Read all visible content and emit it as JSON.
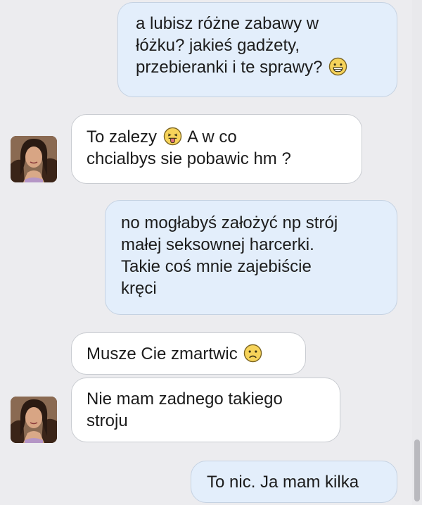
{
  "messages": [
    {
      "sender": "me",
      "lines": [
        "a lubisz różne zabawy w",
        "łóżku? jakieś gadżety,",
        "przebieranki i te sprawy?"
      ],
      "emoji": "grinning-emoji"
    },
    {
      "sender": "them",
      "line1_pre": "To zalezy",
      "line1_emoji": "tongue-out-emoji",
      "line1_post": "A w co",
      "line2": "chcialbys sie pobawic hm ?"
    },
    {
      "sender": "me",
      "lines": [
        "no mogłabyś założyć np strój",
        "małej seksownej harcerki.",
        "Takie coś mnie zajebiście",
        "kręci"
      ]
    },
    {
      "sender": "them",
      "text": "Musze Cie zmartwic",
      "emoji": "frowning-emoji"
    },
    {
      "sender": "them",
      "lines": [
        "Nie mam zadnego takiego",
        "stroju"
      ]
    },
    {
      "sender": "me",
      "text": "To nic. Ja mam kilka"
    }
  ]
}
